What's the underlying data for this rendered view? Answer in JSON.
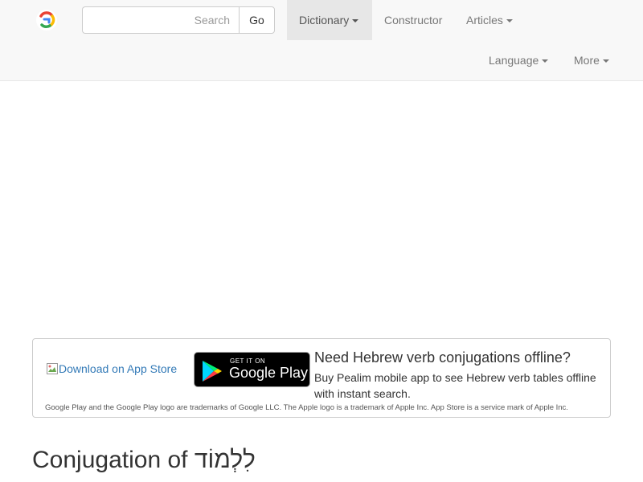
{
  "navbar": {
    "search": {
      "placeholder": "Search",
      "value": ""
    },
    "go_label": "Go",
    "items": [
      {
        "label": "Dictionary",
        "dropdown": true,
        "active": true
      },
      {
        "label": "Constructor",
        "dropdown": false,
        "active": false
      },
      {
        "label": "Articles",
        "dropdown": true,
        "active": false
      },
      {
        "label": "Language",
        "dropdown": true,
        "active": false
      },
      {
        "label": "More",
        "dropdown": true,
        "active": false
      }
    ]
  },
  "promo": {
    "app_store_alt": "Download on App Store",
    "google_play": {
      "small_text": "GET IT ON",
      "big_text": "Google Play"
    },
    "heading": "Need Hebrew verb conjugations offline?",
    "text": "Buy Pealim mobile app to see Hebrew verb tables offline with instant search.",
    "legal": "Google Play and the Google Play logo are trademarks of Google LLC. The Apple logo is a trademark of Apple Inc. App Store is a service mark of Apple Inc."
  },
  "page": {
    "title_prefix": "Conjugation of",
    "title_word": "לִלְמוֹד"
  },
  "colors": {
    "navbar_bg": "#f8f8f8",
    "active_nav_bg": "#e7e7e7",
    "link": "#337ab7"
  }
}
